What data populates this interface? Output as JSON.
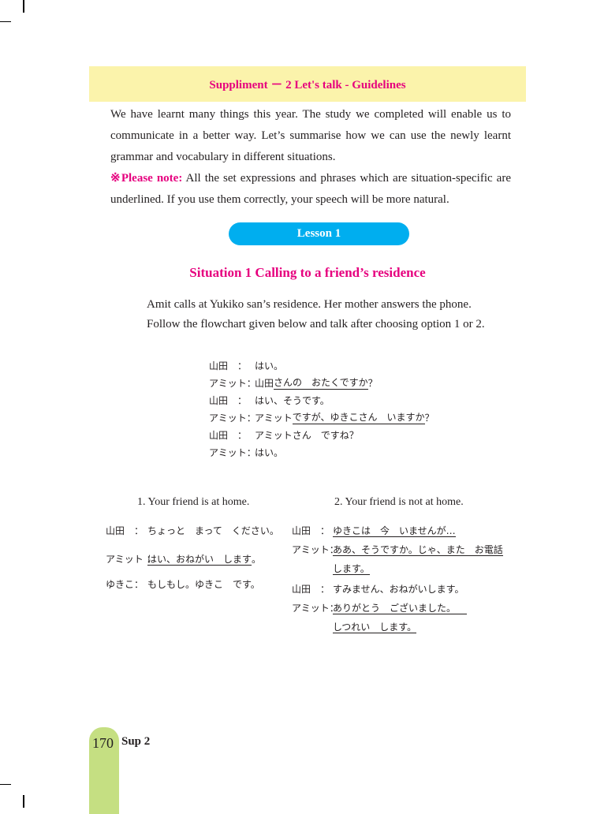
{
  "header": {
    "title": "Suppliment － 2 Let's talk - Guidelines"
  },
  "intro": {
    "paragraph": "We have learnt many things this year. The study we completed will enable us to communicate in a better way. Let’s summarise how we can use the newly learnt grammar and vocabulary in different situations.",
    "note_label": "※Please note:",
    "note_text": "All the set expressions and phrases which are situation-specific are underlined. If you use them correctly, your speech will be more natural."
  },
  "lesson": {
    "label": "Lesson 1"
  },
  "situation": {
    "title": "Situation 1   Calling to a friend’s residence"
  },
  "description": {
    "line1": "Amit calls at Yukiko san’s residence. Her mother answers the phone.",
    "line2": "Follow the flowchart given below and talk after choosing option 1 or 2."
  },
  "dialog": [
    {
      "speaker": "山田　：",
      "pre": "はい。",
      "ul": "",
      "post": ""
    },
    {
      "speaker": "アミット：",
      "pre": "山田",
      "ul": "さんの　おたくですか",
      "post": "？"
    },
    {
      "speaker": "山田　：",
      "pre": "はい、そうです。",
      "ul": "",
      "post": ""
    },
    {
      "speaker": "アミット：",
      "pre": "アミット",
      "ul": "ですが、ゆきこさん　いますか",
      "post": "？"
    },
    {
      "speaker": "山田　：",
      "pre": "アミットさん　ですね？",
      "ul": "",
      "post": ""
    },
    {
      "speaker": "アミット：",
      "pre": "はい。",
      "ul": "",
      "post": ""
    }
  ],
  "option1": {
    "caption": "1. Your friend is at home.",
    "lines": [
      {
        "speaker": "山田　：",
        "text": "ちょっと　まって　ください。",
        "underlined": false
      },
      {
        "speaker": "アミット ：",
        "text": "はい、おねがい　します",
        "underlined": true,
        "post": "。"
      },
      {
        "speaker": "ゆきこ：",
        "text": "もしもし。ゆきこ　です。",
        "underlined": false
      }
    ]
  },
  "option2": {
    "caption": "2. Your friend is not at home.",
    "lines": [
      {
        "speaker": "山田　：",
        "text": "ゆきこは　今　いませんが…",
        "cont": ""
      },
      {
        "speaker": "アミット：",
        "text": "ああ、そうですか。じゃ、また　お電話",
        "cont": "します。"
      },
      {
        "speaker": "山田　：",
        "text": "すみません、おねがいします。",
        "cont": ""
      },
      {
        "speaker": "アミット：",
        "text": "ありがとう　ございました。",
        "cont": "しつれい　します。"
      }
    ]
  },
  "footer": {
    "page_number": "170",
    "section": "Sup 2"
  }
}
